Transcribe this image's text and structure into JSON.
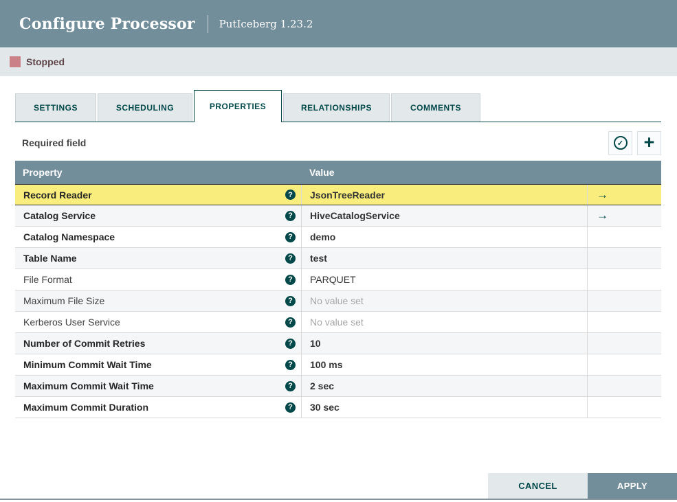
{
  "dialog": {
    "title": "Configure Processor",
    "subtitle": "PutIceberg 1.23.2"
  },
  "status": {
    "label": "Stopped",
    "color": "#ca8187"
  },
  "tabs": [
    {
      "label": "SETTINGS",
      "active": false
    },
    {
      "label": "SCHEDULING",
      "active": false
    },
    {
      "label": "PROPERTIES",
      "active": true
    },
    {
      "label": "RELATIONSHIPS",
      "active": false
    },
    {
      "label": "COMMENTS",
      "active": false
    }
  ],
  "properties_panel": {
    "required_hint": "Required field",
    "verify_icon": "check-circle-icon",
    "add_icon": "plus-icon"
  },
  "icons": {
    "help_glyph": "?",
    "check_glyph": "✓",
    "plus_glyph": "+",
    "arrow_glyph": "→"
  },
  "properties_table": {
    "columns": {
      "property": "Property",
      "value": "Value"
    },
    "rows": [
      {
        "name": "Record Reader",
        "required": true,
        "value": "JsonTreeReader",
        "unset": false,
        "arrow": true,
        "selected": true
      },
      {
        "name": "Catalog Service",
        "required": true,
        "value": "HiveCatalogService",
        "unset": false,
        "arrow": true,
        "selected": false
      },
      {
        "name": "Catalog Namespace",
        "required": true,
        "value": "demo",
        "unset": false,
        "arrow": false,
        "selected": false
      },
      {
        "name": "Table Name",
        "required": true,
        "value": "test",
        "unset": false,
        "arrow": false,
        "selected": false
      },
      {
        "name": "File Format",
        "required": false,
        "value": "PARQUET",
        "unset": false,
        "arrow": false,
        "selected": false
      },
      {
        "name": "Maximum File Size",
        "required": false,
        "value": "No value set",
        "unset": true,
        "arrow": false,
        "selected": false
      },
      {
        "name": "Kerberos User Service",
        "required": false,
        "value": "No value set",
        "unset": true,
        "arrow": false,
        "selected": false
      },
      {
        "name": "Number of Commit Retries",
        "required": true,
        "value": "10",
        "unset": false,
        "arrow": false,
        "selected": false
      },
      {
        "name": "Minimum Commit Wait Time",
        "required": true,
        "value": "100 ms",
        "unset": false,
        "arrow": false,
        "selected": false
      },
      {
        "name": "Maximum Commit Wait Time",
        "required": true,
        "value": "2 sec",
        "unset": false,
        "arrow": false,
        "selected": false
      },
      {
        "name": "Maximum Commit Duration",
        "required": true,
        "value": "30 sec",
        "unset": false,
        "arrow": false,
        "selected": false
      }
    ]
  },
  "footer": {
    "cancel_label": "CANCEL",
    "apply_label": "APPLY"
  },
  "colors": {
    "header_bg": "#728e9b",
    "accent_teal": "#004849",
    "status_bar_bg": "#e2e7ea",
    "stopped_square": "#ca8187",
    "selected_row_bg": "#f9ee7d",
    "row_stripe_bg": "#f4f6f7",
    "tab_inactive_bg": "#e3e8eb"
  }
}
